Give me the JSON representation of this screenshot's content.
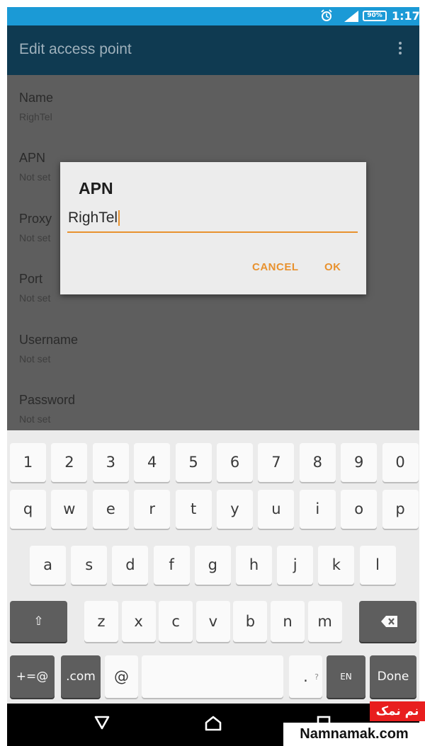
{
  "status_bar": {
    "battery": "90%",
    "time": "1:17",
    "icons": [
      "alarm-icon",
      "signal-icon",
      "battery-icon"
    ],
    "color": "#1b9ad6"
  },
  "action_bar": {
    "title": "Edit access point",
    "menu_icon": "overflow-menu-icon",
    "color": "#0f3a51"
  },
  "settings": [
    {
      "title": "Name",
      "value": "RighTel"
    },
    {
      "title": "APN",
      "value": "Not set"
    },
    {
      "title": "Proxy",
      "value": "Not set"
    },
    {
      "title": "Port",
      "value": "Not set"
    },
    {
      "title": "Username",
      "value": "Not set"
    },
    {
      "title": "Password",
      "value": "Not set"
    }
  ],
  "dialog": {
    "title": "APN",
    "input_value": "RighTel",
    "cancel": "CANCEL",
    "ok": "OK",
    "accent": "#e8922f"
  },
  "keyboard": {
    "row_numbers": [
      "1",
      "2",
      "3",
      "4",
      "5",
      "6",
      "7",
      "8",
      "9",
      "0"
    ],
    "row_top": [
      "q",
      "w",
      "e",
      "r",
      "t",
      "y",
      "u",
      "i",
      "o",
      "p"
    ],
    "row_middle": [
      "a",
      "s",
      "d",
      "f",
      "g",
      "h",
      "j",
      "k",
      "l"
    ],
    "row_bottom": [
      "z",
      "x",
      "c",
      "v",
      "b",
      "n",
      "m"
    ],
    "shift": "⇧",
    "symbols": "+=@",
    "dotcom": ".com",
    "at": "@",
    "period": ".",
    "period_hint": "?",
    "language": "EN",
    "done": "Done"
  },
  "nav_bar": {
    "icons": [
      "back-icon",
      "home-icon",
      "recents-icon"
    ]
  },
  "watermark": {
    "persian": "نم نمک",
    "site": "Namnamak.com"
  }
}
